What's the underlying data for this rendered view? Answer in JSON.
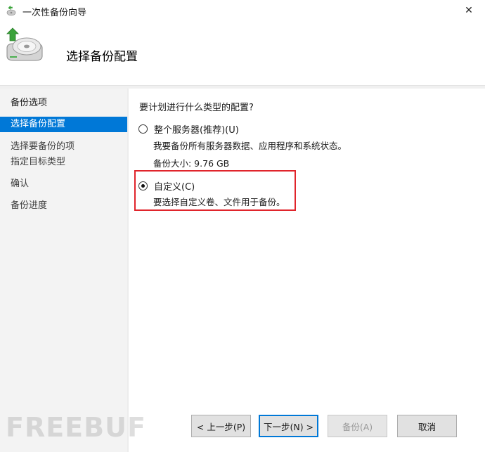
{
  "window": {
    "title": "一次性备份向导",
    "close_glyph": "✕"
  },
  "header": {
    "title": "选择备份配置"
  },
  "sidebar": {
    "items": [
      {
        "label": "备份选项"
      },
      {
        "label": "选择备份配置"
      },
      {
        "label": "选择要备份的项"
      },
      {
        "label": "指定目标类型"
      },
      {
        "label": "确认"
      },
      {
        "label": "备份进度"
      }
    ],
    "selected_index": 1
  },
  "main": {
    "question": "要计划进行什么类型的配置?",
    "options": [
      {
        "label": "整个服务器(推荐)(U)",
        "description": "我要备份所有服务器数据、应用程序和系统状态。",
        "size": "备份大小: 9.76 GB",
        "selected": false
      },
      {
        "label": "自定义(C)",
        "description": "要选择自定义卷、文件用于备份。",
        "selected": true
      }
    ]
  },
  "buttons": {
    "previous": "< 上一步(P)",
    "next": "下一步(N) >",
    "backup": "备份(A)",
    "cancel": "取消"
  },
  "watermark": "FREEBUF",
  "colors": {
    "selection": "#0078d7",
    "highlight_border": "#e0242b",
    "sidebar_bg": "#f3f3f3"
  }
}
